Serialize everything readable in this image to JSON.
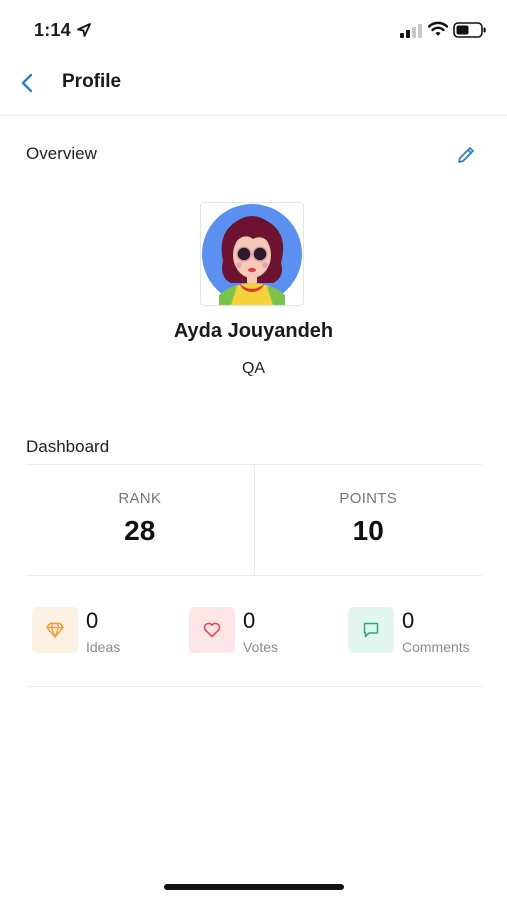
{
  "status_bar": {
    "time": "1:14"
  },
  "nav": {
    "title": "Profile"
  },
  "overview": {
    "label": "Overview"
  },
  "user": {
    "name": "Ayda Jouyandeh",
    "role": "QA"
  },
  "dashboard": {
    "label": "Dashboard",
    "stats": [
      {
        "label": "RANK",
        "value": "28"
      },
      {
        "label": "POINTS",
        "value": "10"
      }
    ],
    "activity": [
      {
        "count": "0",
        "label": "Ideas",
        "icon": "diamond-icon",
        "color": "#f29a3a",
        "bg": "#fdf1e3"
      },
      {
        "count": "0",
        "label": "Votes",
        "icon": "heart-icon",
        "color": "#e0484f",
        "bg": "#fce6e7"
      },
      {
        "count": "0",
        "label": "Comments",
        "icon": "chat-bubble-icon",
        "color": "#2aa88a",
        "bg": "#e2f5ef"
      }
    ]
  },
  "colors": {
    "accent": "#2f7fc1",
    "divider": "#ececec"
  }
}
